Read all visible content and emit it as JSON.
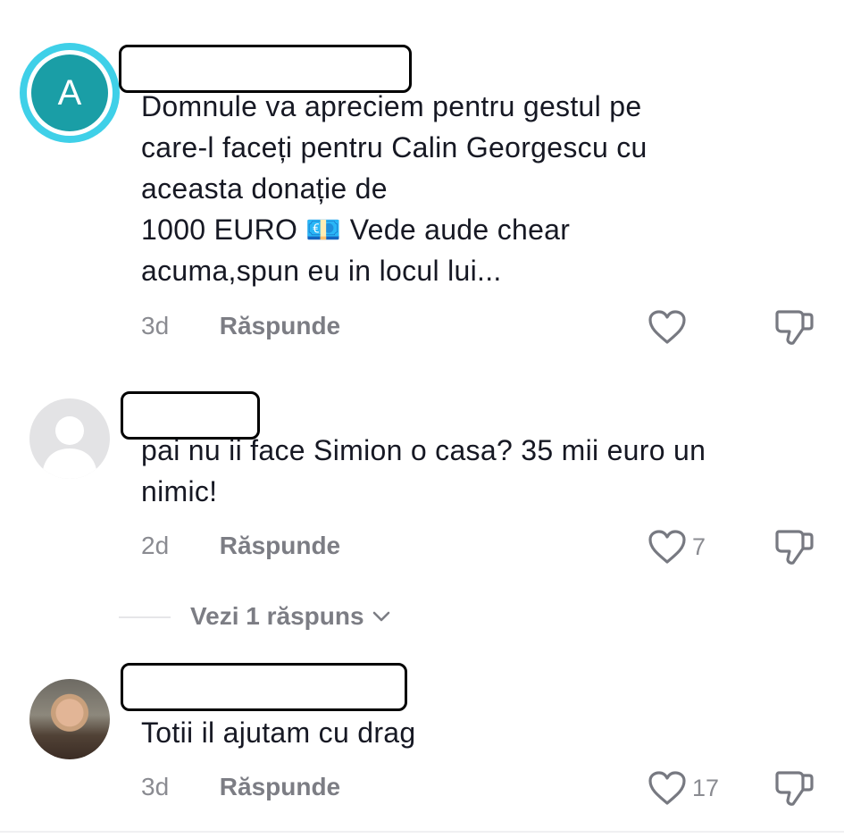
{
  "comments": [
    {
      "avatar_letter": "A",
      "text": "Domnule va apreciem pentru gestul pe\ncare-l faceți pentru Calin Georgescu cu\naceasta donație de\n1000 EURO 💶 Vede aude chear\nacuma,spun eu in locul lui...",
      "time": "3d",
      "reply_label": "Răspunde",
      "like_count": ""
    },
    {
      "text": "pai nu ii face Simion o casa? 35 mii euro un\nnimic!",
      "time": "2d",
      "reply_label": "Răspunde",
      "like_count": "7",
      "view_replies_label": "Vezi 1 răspuns"
    },
    {
      "text": "Totii il ajutam cu drag",
      "time": "3d",
      "reply_label": "Răspunde",
      "like_count": "17"
    }
  ],
  "icons": {
    "like": "heart-outline-icon",
    "dislike": "thumbs-down-icon",
    "expand": "chevron-down-icon"
  },
  "colors": {
    "avatar_accent": "#1a9ea6",
    "avatar_ring": "#3fd0e8",
    "muted_text": "#8a8b91"
  }
}
